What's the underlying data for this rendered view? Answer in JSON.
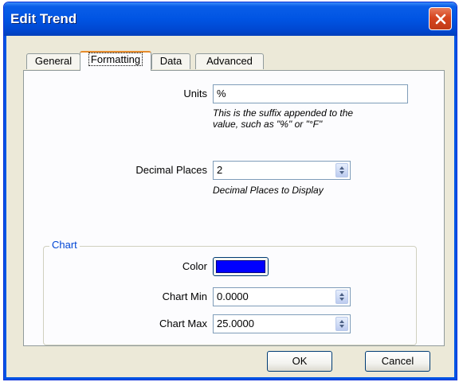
{
  "window": {
    "title": "Edit Trend"
  },
  "tabs": [
    {
      "label": "General"
    },
    {
      "label": "Formatting"
    },
    {
      "label": "Data"
    },
    {
      "label": "Advanced"
    }
  ],
  "units": {
    "label": "Units",
    "value": "%",
    "hint_line1": "This is the suffix appended to the",
    "hint_line2": "value, such as \"%\" or \"°F\""
  },
  "decimal_places": {
    "label": "Decimal Places",
    "value": "2",
    "hint": "Decimal Places to Display"
  },
  "chart": {
    "group_title": "Chart",
    "color_label": "Color",
    "color_value": "#0000ff",
    "min_label": "Chart Min",
    "min_value": "0.0000",
    "max_label": "Chart Max",
    "max_value": "25.0000"
  },
  "buttons": {
    "ok": "OK",
    "cancel": "Cancel"
  }
}
